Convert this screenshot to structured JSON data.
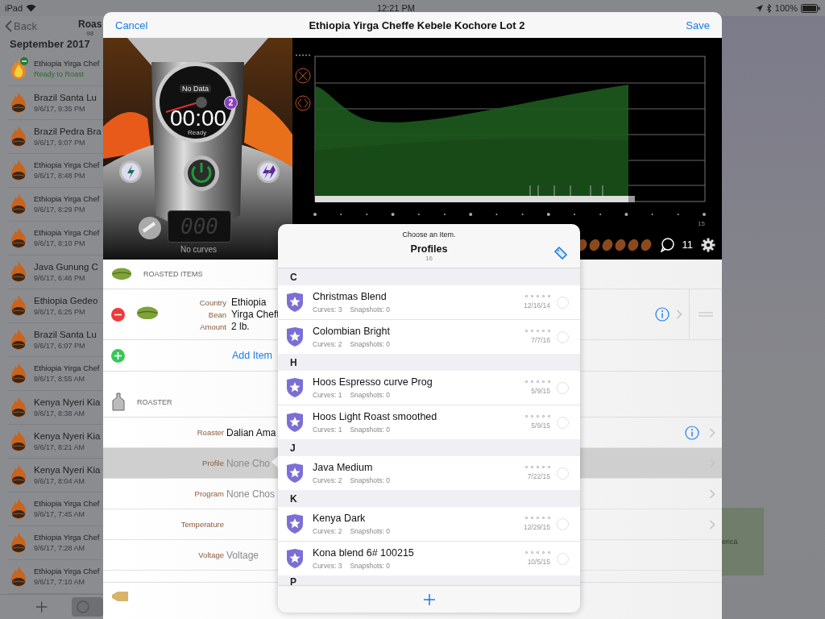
{
  "status_bar": {
    "device": "iPad",
    "time": "12:21 PM",
    "battery": "100%"
  },
  "roast_list": {
    "back": "Back",
    "title": "Roas",
    "subtitle": "98",
    "section": "September 2017",
    "rows": [
      {
        "name": "Ethiopia Yirga Chef",
        "detail": "Ready to Roast",
        "kind": "ready"
      },
      {
        "name": "Brazil Santa Lu",
        "detail": "9/6/17, 9:35 PM",
        "kind": "roasted"
      },
      {
        "name": "Brazil Pedra Bra",
        "detail": "9/6/17, 9:07 PM",
        "kind": "roasted"
      },
      {
        "name": "Ethiopia Yirga Chef",
        "detail": "9/6/17, 8:48 PM",
        "kind": "roasted"
      },
      {
        "name": "Ethiopia Yirga Chef",
        "detail": "9/6/17, 8:29 PM",
        "kind": "roasted"
      },
      {
        "name": "Ethiopia Yirga Chef",
        "detail": "9/6/17, 8:10 PM",
        "kind": "roasted"
      },
      {
        "name": "Java Gunung C",
        "detail": "9/6/17, 6:46 PM",
        "kind": "roasted"
      },
      {
        "name": "Ethiopia Gedeo",
        "detail": "9/6/17, 6:25 PM",
        "kind": "roasted"
      },
      {
        "name": "Brazil Santa Lu",
        "detail": "9/6/17, 6:07 PM",
        "kind": "roasted"
      },
      {
        "name": "Ethiopia Yirga Chef",
        "detail": "9/6/17, 8:55 AM",
        "kind": "roasted"
      },
      {
        "name": "Kenya Nyeri Kia",
        "detail": "9/6/17, 8:38 AM",
        "kind": "roasted"
      },
      {
        "name": "Kenya Nyeri Kia",
        "detail": "9/6/17, 8:21 AM",
        "kind": "roasted"
      },
      {
        "name": "Kenya Nyeri Kia",
        "detail": "9/6/17, 8:04 AM",
        "kind": "roasted"
      },
      {
        "name": "Ethiopia Yirga Chef",
        "detail": "9/6/17, 7:45 AM",
        "kind": "roasted"
      },
      {
        "name": "Ethiopia Yirga Chef",
        "detail": "9/6/17, 7:28 AM",
        "kind": "roasted"
      },
      {
        "name": "Ethiopia Yirga Chef",
        "detail": "9/6/17, 7:10 AM",
        "kind": "roasted"
      }
    ]
  },
  "background_card": {
    "text": "erica"
  },
  "sheet": {
    "cancel": "Cancel",
    "title": "Ethiopia Yirga Cheffe Kebele Kochore Lot 2",
    "save": "Save",
    "dashboard": {
      "gauge_label": "No Data",
      "timer": "00:00",
      "status": "Ready",
      "badge": "2",
      "counter": "000",
      "counter_label": "No curves",
      "axis_end": "15",
      "comment_count": "11"
    },
    "roasted_items": {
      "header": "ROASTED ITEMS",
      "items": [
        {
          "fields": [
            {
              "label": "Country",
              "value": "Ethiopia"
            },
            {
              "label": "Bean",
              "value": "Yirga Cheft"
            },
            {
              "label": "Amount",
              "value": "2 lb."
            }
          ]
        }
      ],
      "add": "Add Item"
    },
    "roaster": {
      "header": "ROASTER",
      "rows": [
        {
          "label": "Roaster",
          "value": "Dalian Ama",
          "info": true,
          "chevron": true,
          "selected": false
        },
        {
          "label": "Profile",
          "placeholder": "None Cho",
          "info": false,
          "chevron": true,
          "selected": true
        },
        {
          "label": "Program",
          "placeholder": "None Chos",
          "info": false,
          "chevron": true,
          "selected": false
        },
        {
          "label": "Temperature",
          "info": false,
          "chevron": true,
          "selected": false
        },
        {
          "label": "Voltage",
          "placeholder": "Voltage",
          "info": false,
          "chevron": false,
          "selected": false
        }
      ]
    }
  },
  "popover": {
    "prompt": "Choose an Item.",
    "title": "Profiles",
    "count": "16",
    "sections": [
      {
        "letter": "C",
        "items": [
          {
            "name": "Christmas Blend",
            "curves": "Curves: 3",
            "snapshots": "Snapshots: 0",
            "date": "12/16/14",
            "stars": 0,
            "selected": false
          },
          {
            "name": "Colombian Bright",
            "curves": "Curves: 2",
            "snapshots": "Snapshots: 0",
            "date": "7/7/16",
            "stars": 0,
            "selected": false
          }
        ]
      },
      {
        "letter": "H",
        "items": [
          {
            "name": "Hoos Espresso curve Prog",
            "curves": "Curves: 1",
            "snapshots": "Snapshots: 0",
            "date": "5/9/15",
            "stars": 0,
            "selected": false
          },
          {
            "name": "Hoos Light Roast smoothed",
            "curves": "Curves: 1",
            "snapshots": "Snapshots: 0",
            "date": "5/9/15",
            "stars": 0,
            "selected": false
          }
        ]
      },
      {
        "letter": "J",
        "items": [
          {
            "name": "Java Medium",
            "curves": "Curves: 2",
            "snapshots": "Snapshots: 0",
            "date": "7/22/15",
            "stars": 0,
            "selected": false
          }
        ]
      },
      {
        "letter": "K",
        "items": [
          {
            "name": "Kenya Dark",
            "curves": "Curves: 2",
            "snapshots": "Snapshots: 0",
            "date": "12/29/15",
            "stars": 0,
            "selected": false
          },
          {
            "name": "Kona blend 6# 100215",
            "curves": "Curves: 3",
            "snapshots": "Snapshots: 0",
            "date": "10/5/15",
            "stars": 0,
            "selected": false
          }
        ]
      },
      {
        "letter": "P"
      }
    ]
  }
}
